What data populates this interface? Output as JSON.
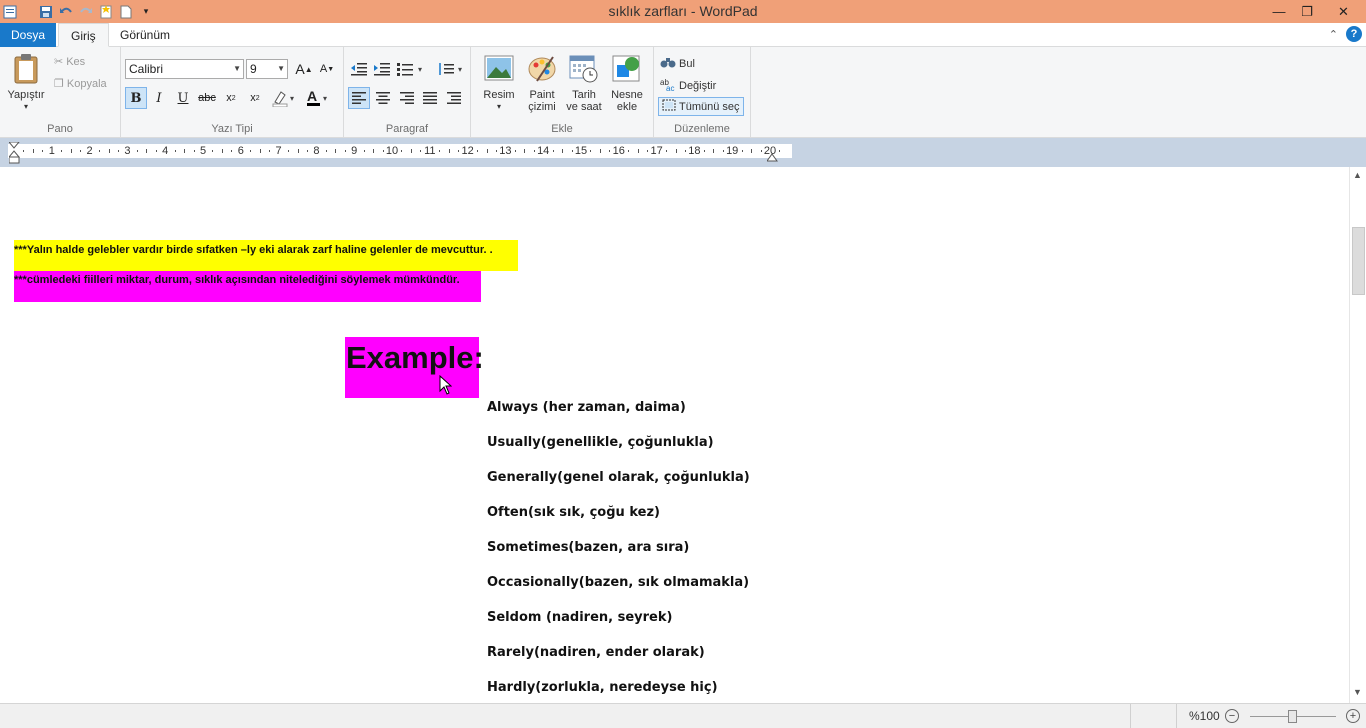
{
  "window": {
    "title": "sıklık zarfları - WordPad",
    "controls": {
      "minimize": "—",
      "maximize": "❐",
      "close": "✕"
    }
  },
  "tabs": {
    "file": "Dosya",
    "home": "Giriş",
    "view": "Görünüm"
  },
  "ribbon": {
    "clipboard": {
      "paste": "Yapıştır",
      "cut": "Kes",
      "copy": "Kopyala",
      "label": "Pano"
    },
    "font": {
      "family": "Calibri",
      "size": "9",
      "label": "Yazı Tipi"
    },
    "paragraph": {
      "label": "Paragraf"
    },
    "insert": {
      "picture": "Resim",
      "paint_line1": "Paint",
      "paint_line2": "çizimi",
      "datetime_line1": "Tarih",
      "datetime_line2": "ve saat",
      "object_line1": "Nesne",
      "object_line2": "ekle",
      "label": "Ekle"
    },
    "editing": {
      "find": "Bul",
      "replace": "Değiştir",
      "select_all": "Tümünü seç",
      "label": "Düzenleme"
    }
  },
  "ruler": {
    "numbers": [
      "1",
      "2",
      "3",
      "4",
      "5",
      "6",
      "7",
      "8",
      "9",
      "10",
      "11",
      "12",
      "13",
      "14",
      "15",
      "16",
      "17",
      "18",
      "19",
      "20"
    ]
  },
  "document": {
    "line1": "***Yalın halde gelebler vardır birde sıfatken –ly eki alarak zarf haline gelenler de mevcuttur. .",
    "line2": "***cümledeki fiilleri miktar, durum, sıklık açısından nitelediğini söylemek mümkündür.",
    "heading": "Example:",
    "words": [
      "Always (her zaman, daima)",
      "Usually(genellikle, çoğunlukla)",
      "Generally(genel olarak, çoğunlukla)",
      "Often(sık sık, çoğu kez)",
      "Sometimes(bazen, ara sıra)",
      "Occasionally(bazen, sık olmamakla)",
      "Seldom (nadiren, seyrek)",
      "Rarely(nadiren, ender olarak)",
      "Hardly(zorlukla, neredeyse hiç)"
    ]
  },
  "status": {
    "zoom": "%100",
    "zoom_level": 1.0
  }
}
